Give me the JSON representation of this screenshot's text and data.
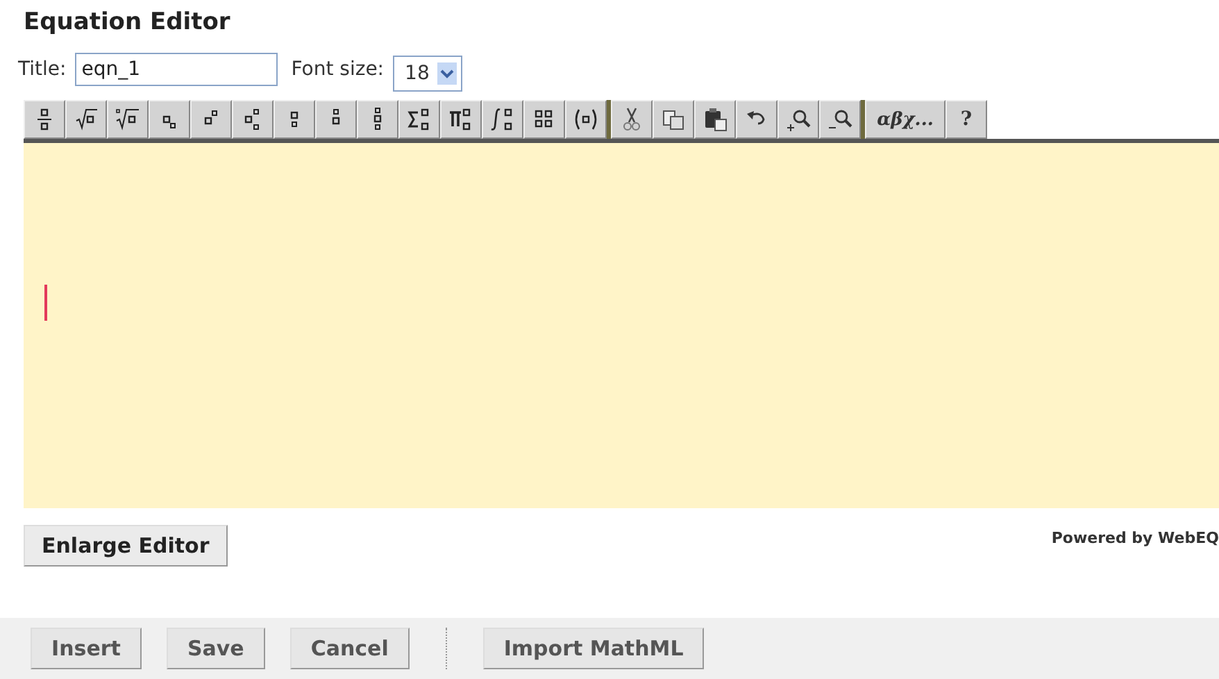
{
  "heading": "Equation Editor",
  "title_field": {
    "label": "Title:",
    "value": "eqn_1"
  },
  "font_size": {
    "label": "Font size:",
    "value": "18"
  },
  "toolbar_groups": [
    {
      "buttons": [
        {
          "kind": "icon"
        },
        {
          "kind": "icon"
        },
        {
          "kind": "icon"
        },
        {
          "kind": "icon"
        },
        {
          "kind": "icon"
        },
        {
          "kind": "icon"
        },
        {
          "kind": "icon"
        },
        {
          "kind": "icon"
        },
        {
          "kind": "icon"
        },
        {
          "kind": "icon"
        },
        {
          "kind": "icon"
        },
        {
          "kind": "icon"
        },
        {
          "kind": "icon"
        },
        {
          "kind": "icon"
        }
      ]
    },
    {
      "buttons": [
        {
          "kind": "icon"
        },
        {
          "kind": "icon"
        },
        {
          "kind": "icon"
        },
        {
          "kind": "icon"
        },
        {
          "kind": "icon"
        },
        {
          "kind": "icon"
        }
      ]
    },
    {
      "buttons": [
        {
          "kind": "text",
          "label": "αβχ..."
        },
        {
          "kind": "text",
          "label": "?"
        }
      ]
    }
  ],
  "enlarge_button": "Enlarge Editor",
  "credit": "Powered by WebEQ",
  "actions": [
    {
      "label": "Insert"
    },
    {
      "label": "Save"
    },
    {
      "label": "Cancel"
    },
    {
      "kind": "separator"
    },
    {
      "label": "Import MathML"
    }
  ]
}
